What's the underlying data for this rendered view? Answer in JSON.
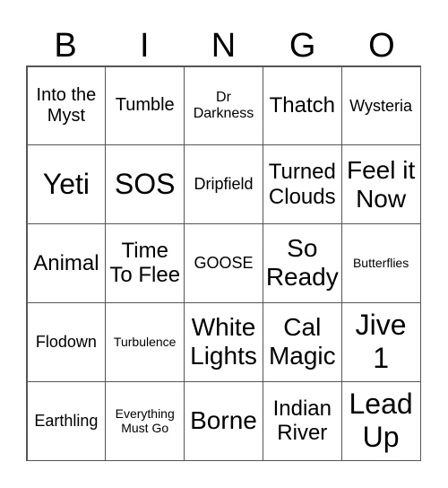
{
  "header": [
    "B",
    "I",
    "N",
    "G",
    "O"
  ],
  "cells": [
    [
      "Into the Myst",
      "Tumble",
      "Dr Darkness",
      "Thatch",
      "Wysteria"
    ],
    [
      "Yeti",
      "SOS",
      "Dripfield",
      "Turned Clouds",
      "Feel it Now"
    ],
    [
      "Animal",
      "Time To Flee",
      "GOOSE",
      "So Ready",
      "Butterflies"
    ],
    [
      "Flodown",
      "Turbulence",
      "White Lights",
      "Cal Magic",
      "Jive 1"
    ],
    [
      "Earthling",
      "Everything Must Go",
      "Borne",
      "Indian River",
      "Lead Up"
    ]
  ]
}
